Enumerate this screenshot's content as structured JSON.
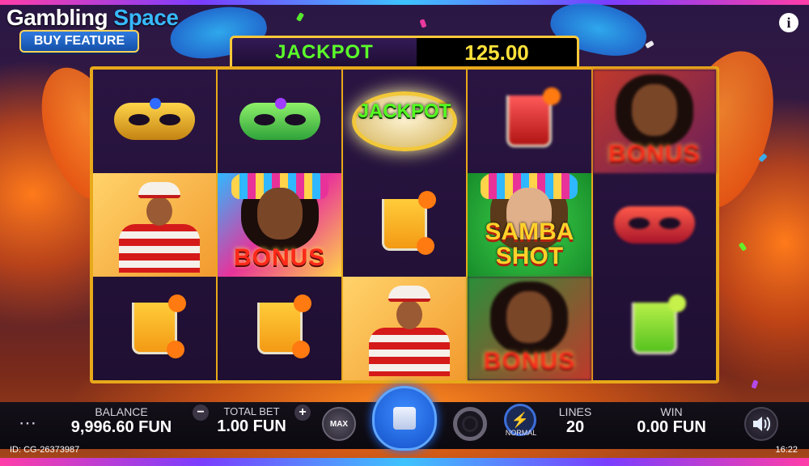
{
  "app": {
    "logo_word1": "Gambling",
    "logo_word2": "Space",
    "buy_feature_label": "BUY FEATURE",
    "info_icon": "i"
  },
  "jackpot": {
    "label": "JACKPOT",
    "value": "125.00"
  },
  "reels": [
    [
      {
        "symbol": "gold-mask"
      },
      {
        "symbol": "dancer-man"
      },
      {
        "symbol": "orange-cocktail"
      }
    ],
    [
      {
        "symbol": "green-mask"
      },
      {
        "symbol": "bonus-woman",
        "label": "BONUS"
      },
      {
        "symbol": "orange-cocktail"
      }
    ],
    [
      {
        "symbol": "jackpot-drum",
        "label": "JACKPOT"
      },
      {
        "symbol": "orange-cocktail"
      },
      {
        "symbol": "dancer-man"
      }
    ],
    [
      {
        "symbol": "red-cocktail"
      },
      {
        "symbol": "samba-shot-wild",
        "label_line1": "SAMBA",
        "label_line2": "SHOT"
      },
      {
        "symbol": "bonus-woman",
        "label": "BONUS"
      }
    ],
    [
      {
        "symbol": "bonus-woman",
        "label": "BONUS"
      },
      {
        "symbol": "red-mask"
      },
      {
        "symbol": "lime-cocktail"
      }
    ]
  ],
  "hud": {
    "menu_icon": "more-dots-icon",
    "balance_label": "BALANCE",
    "balance_value": "9,996.60 FUN",
    "total_bet_label": "TOTAL BET",
    "total_bet_value": "1.00 FUN",
    "bet_minus": "−",
    "bet_plus": "+",
    "max_label": "MAX",
    "spin_icon": "stop-square-icon",
    "autoplay_icon": "autoplay-ring-icon",
    "speed_mode_label": "NORMAL",
    "lines_label": "LINES",
    "lines_value": "20",
    "win_label": "WIN",
    "win_value": "0.00 FUN",
    "sound_icon": "speaker-icon"
  },
  "status": {
    "id_text": "ID: CG-26373987",
    "clock": "16:22"
  },
  "colors": {
    "reel_frame": "#e8a91a",
    "jackpot_label": "#5bff2a",
    "jackpot_value": "#ffe23a",
    "spin_button": "#1f6fe0",
    "logo_accent": "#37b9ff"
  }
}
